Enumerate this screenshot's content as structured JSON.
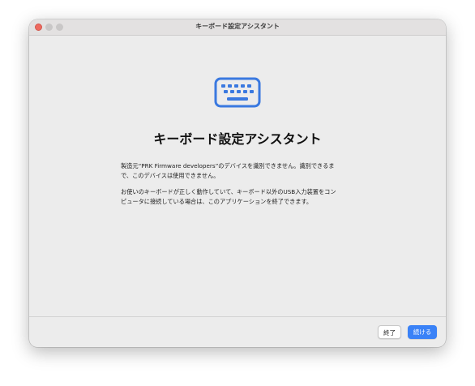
{
  "window": {
    "title": "キーボード設定アシスタント"
  },
  "main": {
    "icon": "keyboard-icon",
    "heading": "キーボード設定アシスタント",
    "paragraph1": "製造元“PRK Firmware developers”のデバイスを識別できません。識別できるま\nで、このデバイスは使用できません。",
    "paragraph2": "お使いのキーボードが正しく動作していて、キーボード以外のUSB入力装置をコン\nピュータに接続している場合は、このアプリケーションを終了できます。"
  },
  "footer": {
    "quit_label": "終了",
    "continue_label": "続ける"
  },
  "colors": {
    "accent": "#3a82f7",
    "icon": "#3a79e0",
    "close_button": "#ee6a5f"
  }
}
